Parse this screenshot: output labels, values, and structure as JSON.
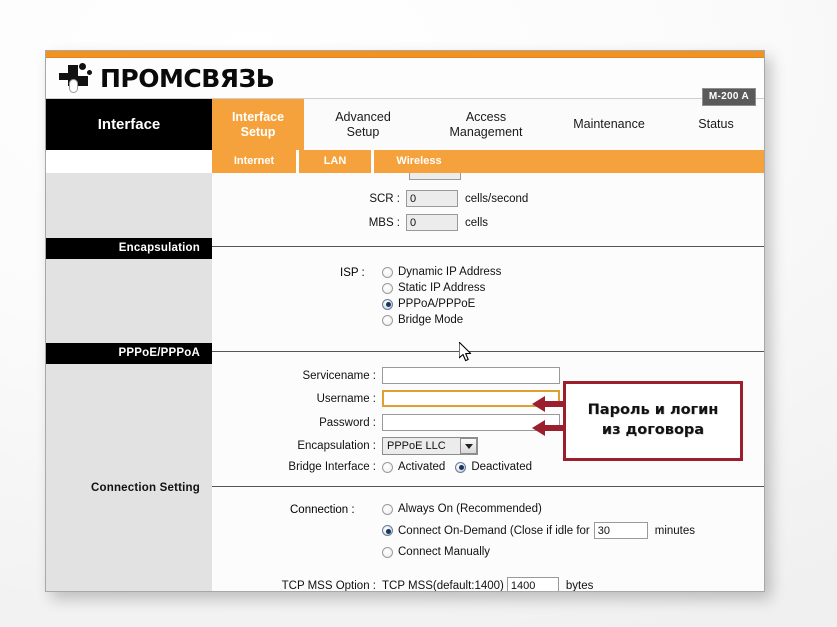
{
  "brand": {
    "logo_text": "ПРОМСВЯЗЬ",
    "logo_icon": "promsvyaz-logo-icon",
    "model_badge": "M-200 A"
  },
  "tabs": {
    "section_tab": "Interface",
    "items": [
      {
        "label": "Interface\nSetup",
        "line1": "Interface",
        "line2": "Setup",
        "active": true
      },
      {
        "label": "Advanced Setup",
        "line1": "Advanced",
        "line2": "Setup",
        "active": false
      },
      {
        "label": "Access Management",
        "line1": "Access",
        "line2": "Management",
        "active": false
      },
      {
        "label": "Maintenance",
        "line1": "Maintenance",
        "line2": "",
        "active": false
      },
      {
        "label": "Status",
        "line1": "Status",
        "line2": "",
        "active": false
      }
    ]
  },
  "subtabs": {
    "items": [
      {
        "label": "Internet",
        "active": true
      },
      {
        "label": "LAN",
        "active": false
      },
      {
        "label": "Wireless",
        "active": false
      }
    ]
  },
  "sections": {
    "encapsulation": "Encapsulation",
    "pppoe_pppoa": "PPPoE/PPPoA",
    "connection_setting": "Connection Setting"
  },
  "atm_qos": {
    "scr_label": "SCR :",
    "scr_value": "0",
    "scr_unit": "cells/second",
    "mbs_label": "MBS :",
    "mbs_value": "0",
    "mbs_unit": "cells"
  },
  "isp": {
    "label": "ISP :",
    "options": [
      {
        "label": "Dynamic IP Address",
        "selected": false
      },
      {
        "label": "Static IP Address",
        "selected": false
      },
      {
        "label": "PPPoA/PPPoE",
        "selected": true
      },
      {
        "label": "Bridge Mode",
        "selected": false
      }
    ]
  },
  "pppoe": {
    "servicename_label": "Servicename :",
    "servicename_value": "",
    "username_label": "Username :",
    "username_value": "",
    "password_label": "Password :",
    "password_value": "",
    "encapsulation_label": "Encapsulation :",
    "encapsulation_value": "PPPoE LLC",
    "bridge_interface_label": "Bridge Interface :",
    "bridge_options": [
      {
        "label": "Activated",
        "selected": false
      },
      {
        "label": "Deactivated",
        "selected": true
      }
    ]
  },
  "connection": {
    "label": "Connection :",
    "options": [
      {
        "label": "Always On (Recommended)",
        "selected": false
      },
      {
        "label": "Connect On-Demand (Close if idle for",
        "selected": true
      },
      {
        "label": "Connect Manually",
        "selected": false
      }
    ],
    "idle_value": "30",
    "idle_unit": "minutes",
    "tcp_mss_label": "TCP MSS Option :",
    "tcp_mss_text": "TCP MSS(default:1400)",
    "tcp_mss_value": "1400",
    "tcp_mss_unit": "bytes"
  },
  "annotation": {
    "line1": "Пароль и логин",
    "line2": "из договора",
    "border_color": "#9c1f2e",
    "arrow_color": "#9c1f2e"
  },
  "colors": {
    "accent_orange": "#f6a23c",
    "top_strip": "#f29222",
    "black_tab": "#000000",
    "sidebar": "#e2e2e2",
    "focus_border": "#e0a030"
  }
}
